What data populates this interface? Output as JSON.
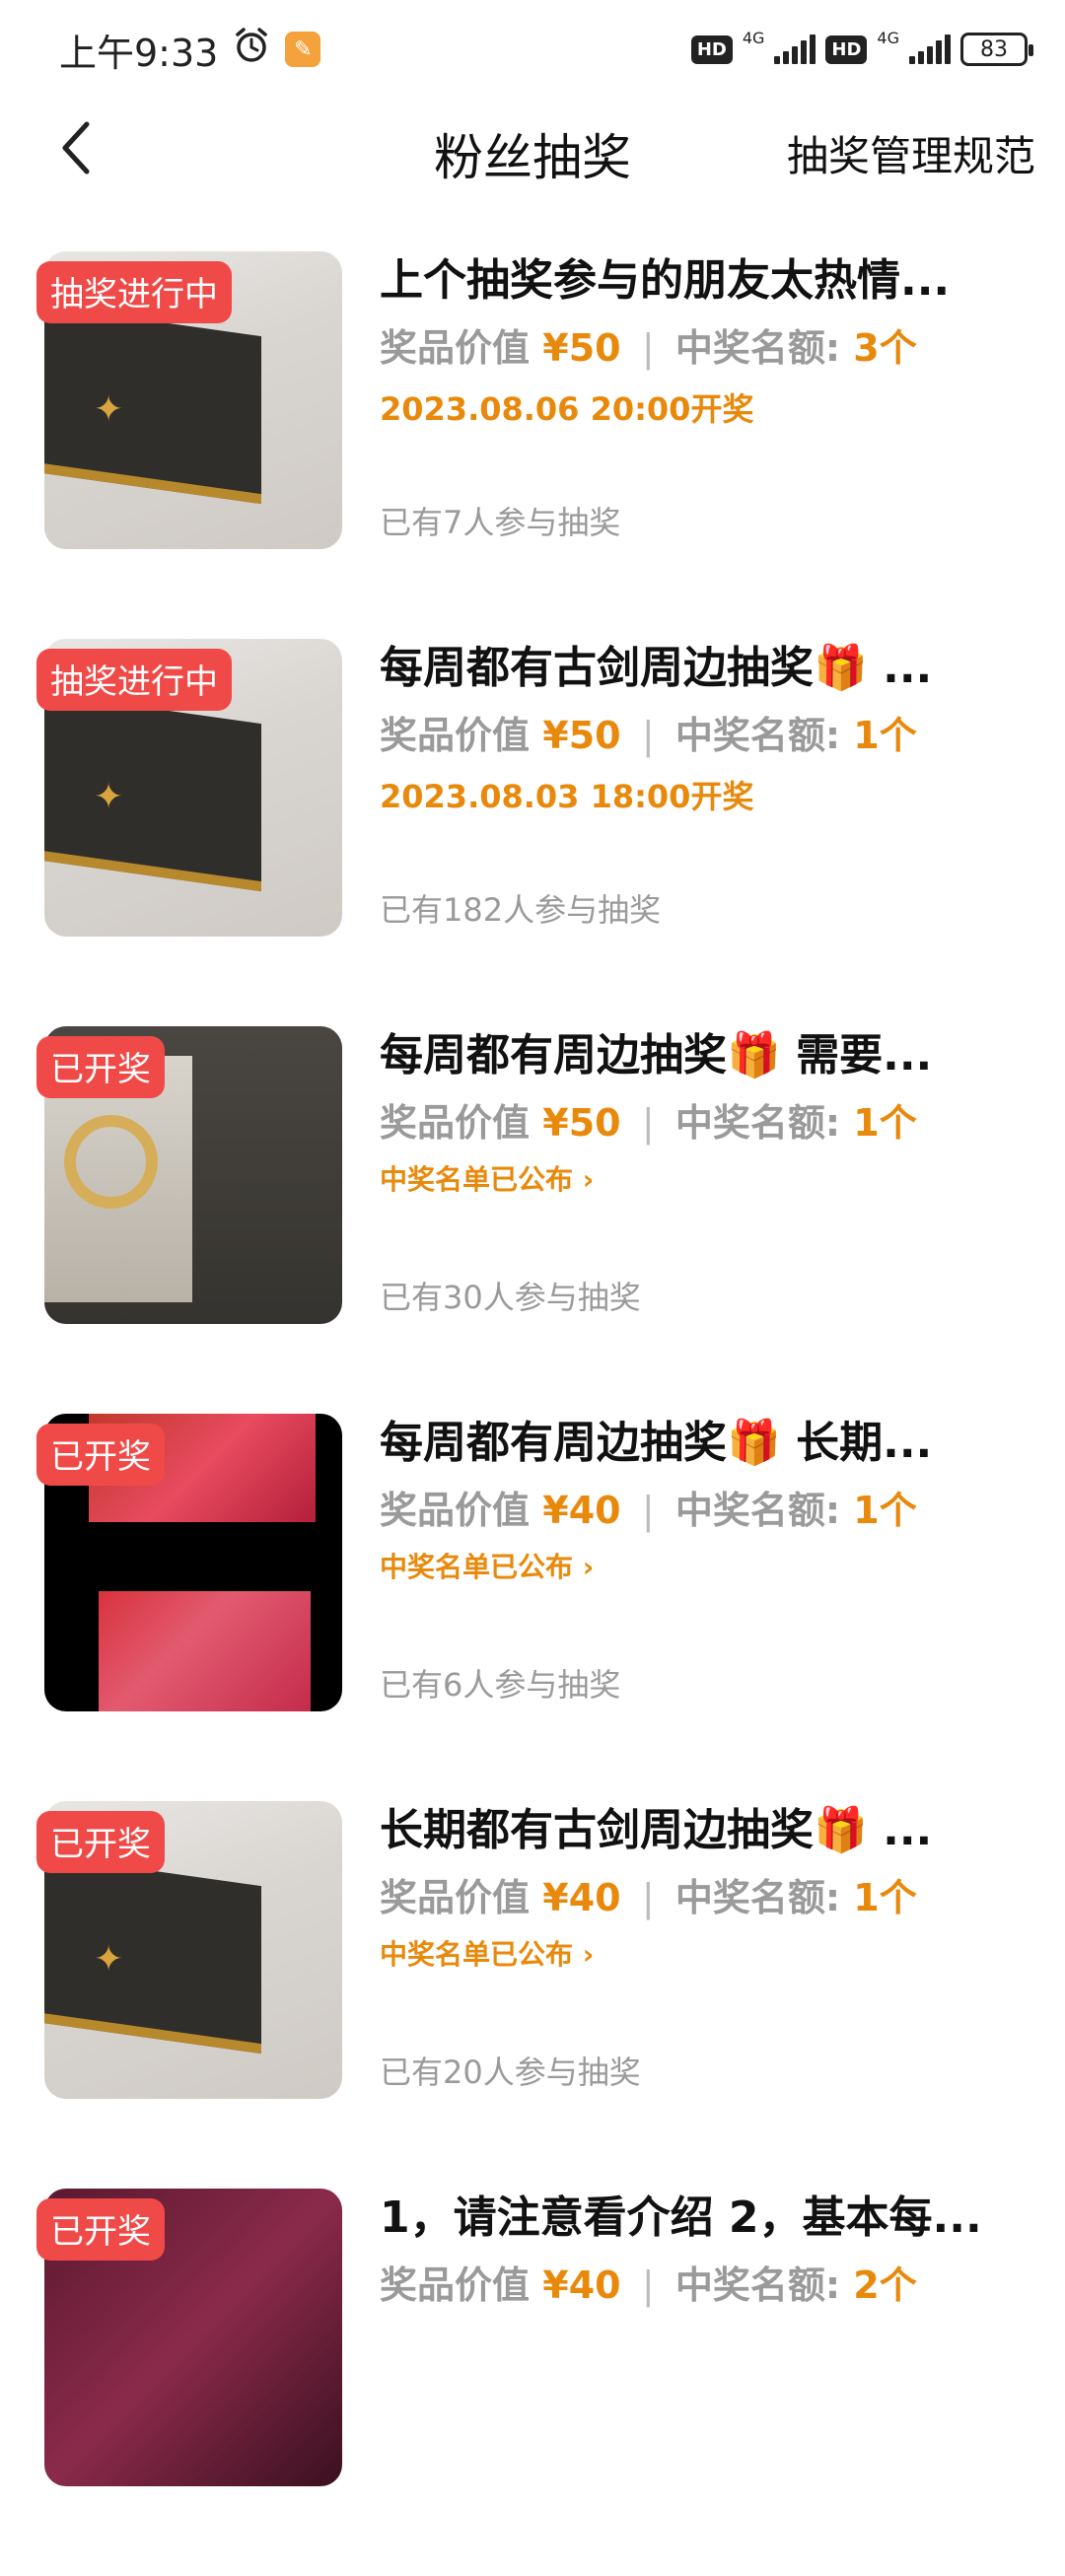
{
  "status_bar": {
    "time": "上午9:33",
    "alarm_icon": "alarm-clock-icon",
    "network1": "4G",
    "network2": "4G",
    "hd_label": "HD",
    "battery": "83"
  },
  "header": {
    "title": "粉丝抽奖",
    "rules_link": "抽奖管理规范"
  },
  "items": [
    {
      "tag": "抽奖进行中",
      "title": "上个抽奖参与的朋友太热情...",
      "price_label": "奖品价值",
      "price": "¥50",
      "sep": "|",
      "winners_label": "中奖名额:",
      "winners": "3个",
      "draw_time": "2023.08.06 20:00开奖",
      "participants": "已有7人参与抽奖"
    },
    {
      "tag": "抽奖进行中",
      "title": "每周都有古剑周边抽奖🎁 ...",
      "price_label": "奖品价值",
      "price": "¥50",
      "sep": "|",
      "winners_label": "中奖名额:",
      "winners": "1个",
      "draw_time": "2023.08.03 18:00开奖",
      "participants": "已有182人参与抽奖"
    },
    {
      "tag": "已开奖",
      "title": "每周都有周边抽奖🎁 需要...",
      "price_label": "奖品价值",
      "price": "¥50",
      "sep": "|",
      "winners_label": "中奖名额:",
      "winners": "1个",
      "announce": "中奖名单已公布 ›",
      "participants": "已有30人参与抽奖"
    },
    {
      "tag": "已开奖",
      "title": "每周都有周边抽奖🎁 长期...",
      "price_label": "奖品价值",
      "price": "¥40",
      "sep": "|",
      "winners_label": "中奖名额:",
      "winners": "1个",
      "announce": "中奖名单已公布 ›",
      "participants": "已有6人参与抽奖"
    },
    {
      "tag": "已开奖",
      "title": "长期都有古剑周边抽奖🎁 ...",
      "price_label": "奖品价值",
      "price": "¥40",
      "sep": "|",
      "winners_label": "中奖名额:",
      "winners": "1个",
      "announce": "中奖名单已公布 ›",
      "participants": "已有20人参与抽奖"
    },
    {
      "tag": "已开奖",
      "title": "1，请注意看介绍 2，基本每...",
      "price_label": "奖品价值",
      "price": "¥40",
      "sep": "|",
      "winners_label": "中奖名额:",
      "winners": "2个"
    }
  ]
}
